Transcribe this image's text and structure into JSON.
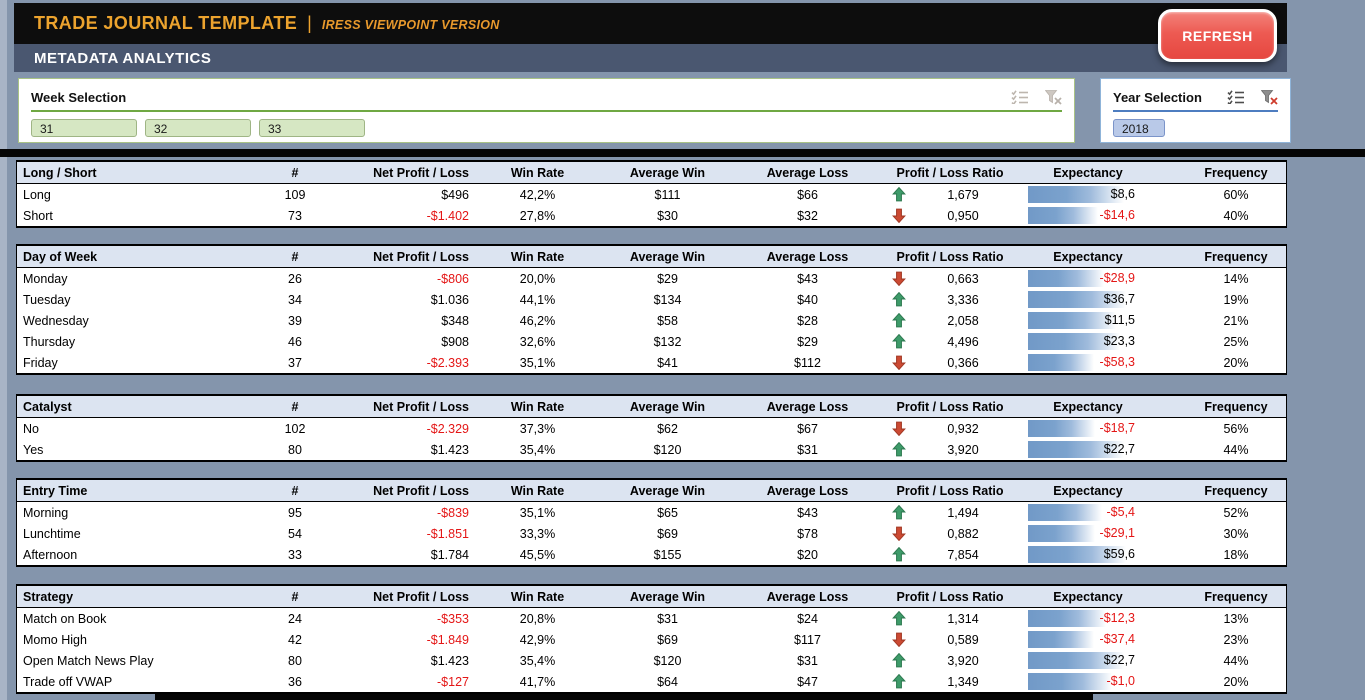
{
  "header": {
    "title": "TRADE JOURNAL TEMPLATE",
    "separator": "|",
    "subtitle": "IRESS VIEWPOINT VERSION",
    "section_title": "METADATA ANALYTICS",
    "refresh_label": "REFRESH"
  },
  "slicers": {
    "week": {
      "title": "Week Selection",
      "items": [
        "31",
        "32",
        "33"
      ],
      "enabled_icons": false
    },
    "year": {
      "title": "Year Selection",
      "items": [
        "2018"
      ],
      "enabled_icons": true
    }
  },
  "columns": {
    "count": "#",
    "net": "Net Profit / Loss",
    "win_rate": "Win Rate",
    "avg_win": "Average Win",
    "avg_loss": "Average Loss",
    "ratio": "Profit / Loss Ratio",
    "expectancy": "Expectancy",
    "frequency": "Frequency"
  },
  "tables": [
    {
      "title": "Long / Short",
      "rows": [
        {
          "label": "Long",
          "count": "109",
          "net": "$496",
          "net_negative": false,
          "win_rate": "42,2%",
          "avg_win": "$111",
          "avg_loss": "$66",
          "trend": "up",
          "ratio": "1,679",
          "expectancy": "$8,6",
          "expectancy_negative": false,
          "bar_pct": 80,
          "frequency": "60%"
        },
        {
          "label": "Short",
          "count": "73",
          "net": "-$1.402",
          "net_negative": true,
          "win_rate": "27,8%",
          "avg_win": "$30",
          "avg_loss": "$32",
          "trend": "down",
          "ratio": "0,950",
          "expectancy": "-$14,6",
          "expectancy_negative": true,
          "bar_pct": 58,
          "frequency": "40%"
        }
      ]
    },
    {
      "title": "Day of Week",
      "rows": [
        {
          "label": "Monday",
          "count": "26",
          "net": "-$806",
          "net_negative": true,
          "win_rate": "20,0%",
          "avg_win": "$29",
          "avg_loss": "$43",
          "trend": "down",
          "ratio": "0,663",
          "expectancy": "-$28,9",
          "expectancy_negative": true,
          "bar_pct": 63,
          "frequency": "14%"
        },
        {
          "label": "Tuesday",
          "count": "34",
          "net": "$1.036",
          "net_negative": false,
          "win_rate": "44,1%",
          "avg_win": "$134",
          "avg_loss": "$40",
          "trend": "up",
          "ratio": "3,336",
          "expectancy": "$36,7",
          "expectancy_negative": false,
          "bar_pct": 82,
          "frequency": "19%"
        },
        {
          "label": "Wednesday",
          "count": "39",
          "net": "$348",
          "net_negative": false,
          "win_rate": "46,2%",
          "avg_win": "$58",
          "avg_loss": "$28",
          "trend": "up",
          "ratio": "2,058",
          "expectancy": "$11,5",
          "expectancy_negative": false,
          "bar_pct": 73,
          "frequency": "21%"
        },
        {
          "label": "Thursday",
          "count": "46",
          "net": "$908",
          "net_negative": false,
          "win_rate": "32,6%",
          "avg_win": "$132",
          "avg_loss": "$29",
          "trend": "up",
          "ratio": "4,496",
          "expectancy": "$23,3",
          "expectancy_negative": false,
          "bar_pct": 77,
          "frequency": "25%"
        },
        {
          "label": "Friday",
          "count": "37",
          "net": "-$2.393",
          "net_negative": true,
          "win_rate": "35,1%",
          "avg_win": "$41",
          "avg_loss": "$112",
          "trend": "down",
          "ratio": "0,366",
          "expectancy": "-$58,3",
          "expectancy_negative": true,
          "bar_pct": 55,
          "frequency": "20%"
        }
      ]
    },
    {
      "title": "Catalyst",
      "rows": [
        {
          "label": "No",
          "count": "102",
          "net": "-$2.329",
          "net_negative": true,
          "win_rate": "37,3%",
          "avg_win": "$62",
          "avg_loss": "$67",
          "trend": "down",
          "ratio": "0,932",
          "expectancy": "-$18,7",
          "expectancy_negative": true,
          "bar_pct": 56,
          "frequency": "56%"
        },
        {
          "label": "Yes",
          "count": "80",
          "net": "$1.423",
          "net_negative": false,
          "win_rate": "35,4%",
          "avg_win": "$120",
          "avg_loss": "$31",
          "trend": "up",
          "ratio": "3,920",
          "expectancy": "$22,7",
          "expectancy_negative": false,
          "bar_pct": 80,
          "frequency": "44%"
        }
      ]
    },
    {
      "title": "Entry Time",
      "rows": [
        {
          "label": "Morning",
          "count": "95",
          "net": "-$839",
          "net_negative": true,
          "win_rate": "35,1%",
          "avg_win": "$65",
          "avg_loss": "$43",
          "trend": "up",
          "ratio": "1,494",
          "expectancy": "-$5,4",
          "expectancy_negative": true,
          "bar_pct": 62,
          "frequency": "52%"
        },
        {
          "label": "Lunchtime",
          "count": "54",
          "net": "-$1.851",
          "net_negative": true,
          "win_rate": "33,3%",
          "avg_win": "$69",
          "avg_loss": "$78",
          "trend": "down",
          "ratio": "0,882",
          "expectancy": "-$29,1",
          "expectancy_negative": true,
          "bar_pct": 56,
          "frequency": "30%"
        },
        {
          "label": "Afternoon",
          "count": "33",
          "net": "$1.784",
          "net_negative": false,
          "win_rate": "45,5%",
          "avg_win": "$155",
          "avg_loss": "$20",
          "trend": "up",
          "ratio": "7,854",
          "expectancy": "$59,6",
          "expectancy_negative": false,
          "bar_pct": 82,
          "frequency": "18%"
        }
      ]
    },
    {
      "title": "Strategy",
      "rows": [
        {
          "label": "Match on Book",
          "count": "24",
          "net": "-$353",
          "net_negative": true,
          "win_rate": "20,8%",
          "avg_win": "$31",
          "avg_loss": "$24",
          "trend": "up",
          "ratio": "1,314",
          "expectancy": "-$12,3",
          "expectancy_negative": true,
          "bar_pct": 65,
          "frequency": "13%"
        },
        {
          "label": "Momo High",
          "count": "42",
          "net": "-$1.849",
          "net_negative": true,
          "win_rate": "42,9%",
          "avg_win": "$69",
          "avg_loss": "$117",
          "trend": "down",
          "ratio": "0,589",
          "expectancy": "-$37,4",
          "expectancy_negative": true,
          "bar_pct": 55,
          "frequency": "23%"
        },
        {
          "label": "Open Match News Play",
          "count": "80",
          "net": "$1.423",
          "net_negative": false,
          "win_rate": "35,4%",
          "avg_win": "$120",
          "avg_loss": "$31",
          "trend": "up",
          "ratio": "3,920",
          "expectancy": "$22,7",
          "expectancy_negative": false,
          "bar_pct": 80,
          "frequency": "44%"
        },
        {
          "label": "Trade off VWAP",
          "count": "36",
          "net": "-$127",
          "net_negative": true,
          "win_rate": "41,7%",
          "avg_win": "$64",
          "avg_loss": "$47",
          "trend": "up",
          "ratio": "1,349",
          "expectancy": "-$1,0",
          "expectancy_negative": true,
          "bar_pct": 70,
          "frequency": "20%"
        }
      ]
    }
  ],
  "colors": {
    "accent_gold": "#ECA32E",
    "refresh_red": "#ED5A52",
    "section_slate": "#4A5770",
    "table_header_bg": "#DCE4F1",
    "negative_red": "#E41616",
    "arrow_up_green": "#3E9B6A",
    "arrow_down_red": "#CC4A33",
    "databar_blue": "#7199C7",
    "week_button_green": "#D6E7C3",
    "year_button_blue": "#B9C9E8"
  }
}
